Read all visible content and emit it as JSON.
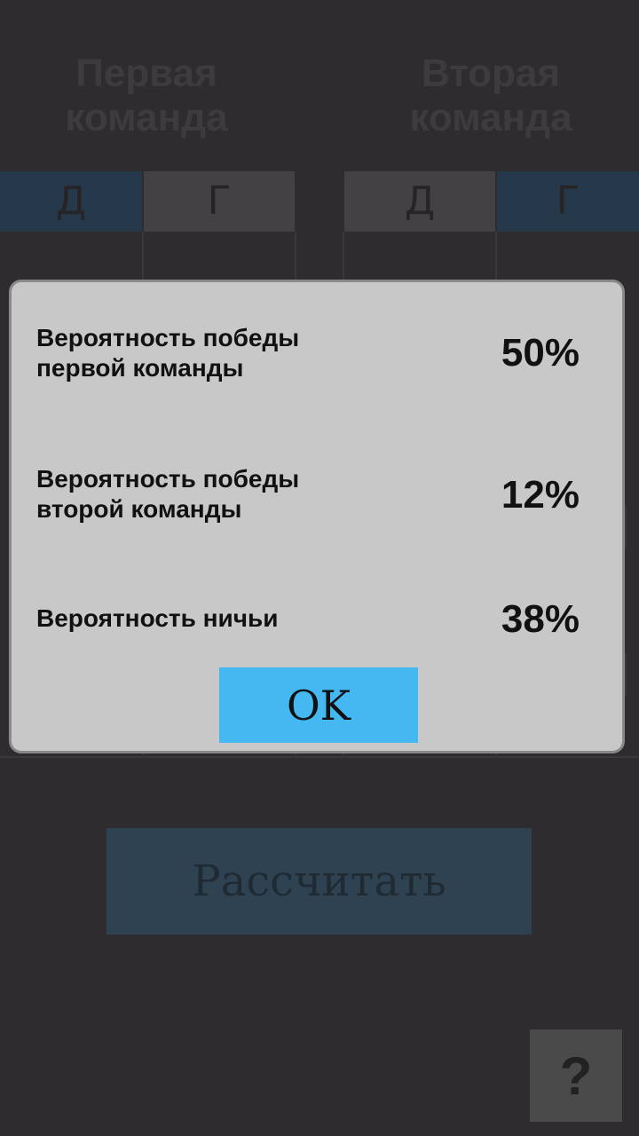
{
  "teams": {
    "first_title": "Первая\nкоманда",
    "second_title": "Вторая\nкоманда",
    "home_tab": "Д",
    "away_tab": "Г"
  },
  "calculate_label": "Рассчитать",
  "help_label": "?",
  "dialog": {
    "rows": [
      {
        "label": "Вероятность победы\nпервой команды",
        "value": "50%"
      },
      {
        "label": "Вероятность победы\nвторой команды",
        "value": "12%"
      },
      {
        "label": "Вероятность ничьи",
        "value": "38%"
      }
    ],
    "ok_label": "OK"
  },
  "colors": {
    "background": "#2f2c2f",
    "dialog_background": "#c9c8c9",
    "ok_button": "#45b8f2",
    "active_tab": "#26394a",
    "calculate_button": "#2e4251"
  }
}
